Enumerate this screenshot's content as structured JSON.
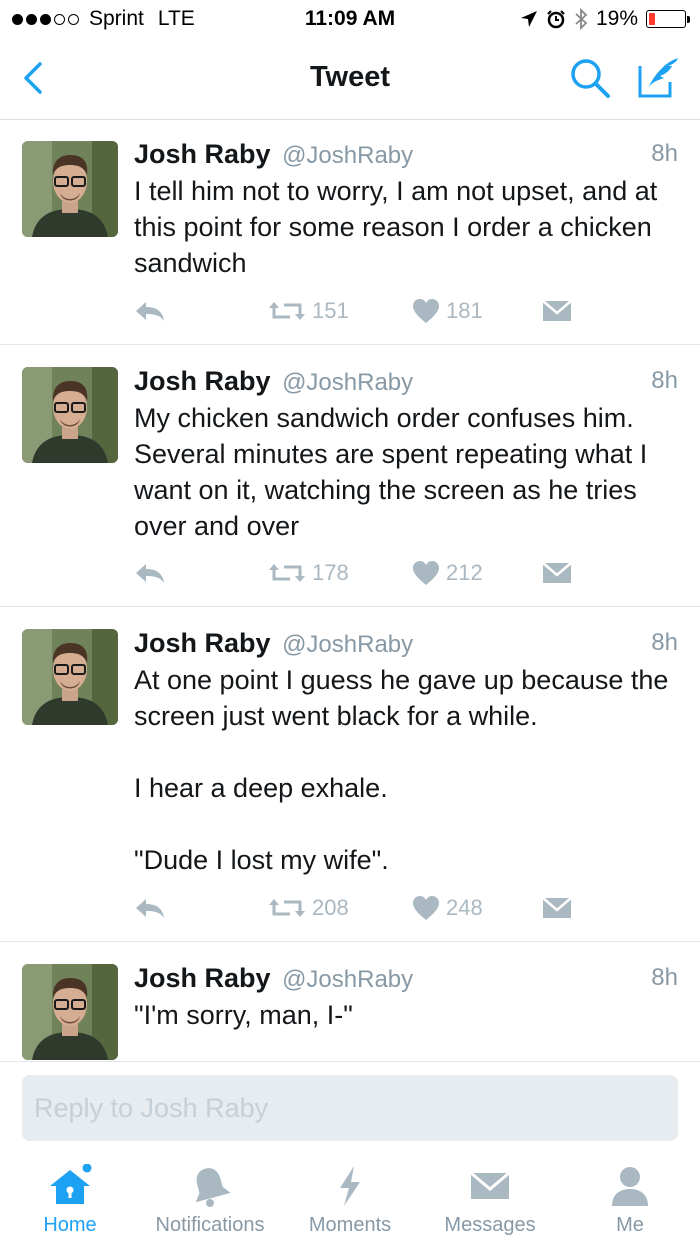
{
  "status": {
    "carrier": "Sprint",
    "network": "LTE",
    "time": "11:09 AM",
    "battery": "19%",
    "battery_level": 0.19,
    "signal_dots_filled": 3,
    "signal_dots_total": 5
  },
  "nav": {
    "title": "Tweet",
    "back_icon": "chevron-left-icon",
    "search_icon": "search-icon",
    "compose_icon": "compose-icon"
  },
  "colors": {
    "accent": "#1da1f2",
    "text": "#14171a",
    "muted": "#8899a6",
    "action": "#aab8c2",
    "battery_low": "#ff3b30"
  },
  "tweets": [
    {
      "name": "Josh Raby",
      "handle": "@JoshRaby",
      "time": "8h",
      "text": "I tell him not to worry, I am not upset, and at this point for some reason I order a chicken sandwich",
      "retweets": "151",
      "likes": "181"
    },
    {
      "name": "Josh Raby",
      "handle": "@JoshRaby",
      "time": "8h",
      "text": "My chicken sandwich order confuses him. Several minutes are spent repeating what I want on it, watching the screen as he tries over and over",
      "retweets": "178",
      "likes": "212"
    },
    {
      "name": "Josh Raby",
      "handle": "@JoshRaby",
      "time": "8h",
      "text": "At one point I guess he gave up because the screen just went black for a while.\n\nI hear a deep exhale.\n\n\"Dude I lost my wife\".",
      "retweets": "208",
      "likes": "248"
    },
    {
      "name": "Josh Raby",
      "handle": "@JoshRaby",
      "time": "8h",
      "text": "\"I'm sorry, man, I-\""
    }
  ],
  "reply": {
    "placeholder": "Reply to Josh Raby",
    "value": ""
  },
  "tabs": [
    {
      "label": "Home",
      "icon": "home-icon",
      "active": true
    },
    {
      "label": "Notifications",
      "icon": "bell-icon",
      "active": false
    },
    {
      "label": "Moments",
      "icon": "lightning-icon",
      "active": false
    },
    {
      "label": "Messages",
      "icon": "envelope-icon",
      "active": false
    },
    {
      "label": "Me",
      "icon": "person-icon",
      "active": false
    }
  ]
}
